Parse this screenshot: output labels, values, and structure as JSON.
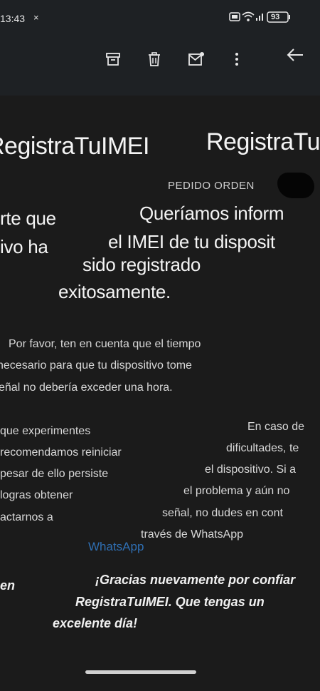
{
  "status_bar": {
    "time": "13:43",
    "close_glyph": "×",
    "battery": "93"
  },
  "toolbar": {
    "icons": [
      "archive-icon",
      "delete-icon",
      "mark-unread-icon",
      "more-options-icon",
      "back-arrow-icon"
    ]
  },
  "email": {
    "title_left": "RegistraTuIMEI",
    "title_right": "RegistraTu",
    "label": "PEDIDO ORDEN",
    "heading_right": {
      "line1": "Queríamos inform",
      "line2": "el IMEI de tu disposit"
    },
    "heading_left": {
      "line1": "rte que",
      "line2": "ivo ha"
    },
    "heading_center": {
      "line1": "sido registrado",
      "line2": "exitosamente."
    },
    "paragraph1": {
      "line1": "Por favor, ten en cuenta que el tiempo",
      "line2": "necesario para que tu dispositivo tome",
      "line3": "señal no debería exceder una hora."
    },
    "paragraph2_right": {
      "line1": "En caso de",
      "line2": "dificultades, te",
      "line3": "el dispositivo. Si a",
      "line4": "el problema y aún no",
      "line5": "señal, no dudes en cont",
      "line6": "través de WhatsApp"
    },
    "paragraph2_left": {
      "line1": "que experimentes",
      "line2": "recomendamos reiniciar",
      "line3": "pesar de ello persiste",
      "line4": "logras obtener",
      "line5": "actarnos a"
    },
    "whatsapp_link": "WhatsApp",
    "closing": {
      "line1a": "¡Gracias nuevamente por confiar",
      "line1b": "en",
      "line2": "RegistraTuIMEI. Que tengas un",
      "line3": "excelente día!"
    }
  }
}
